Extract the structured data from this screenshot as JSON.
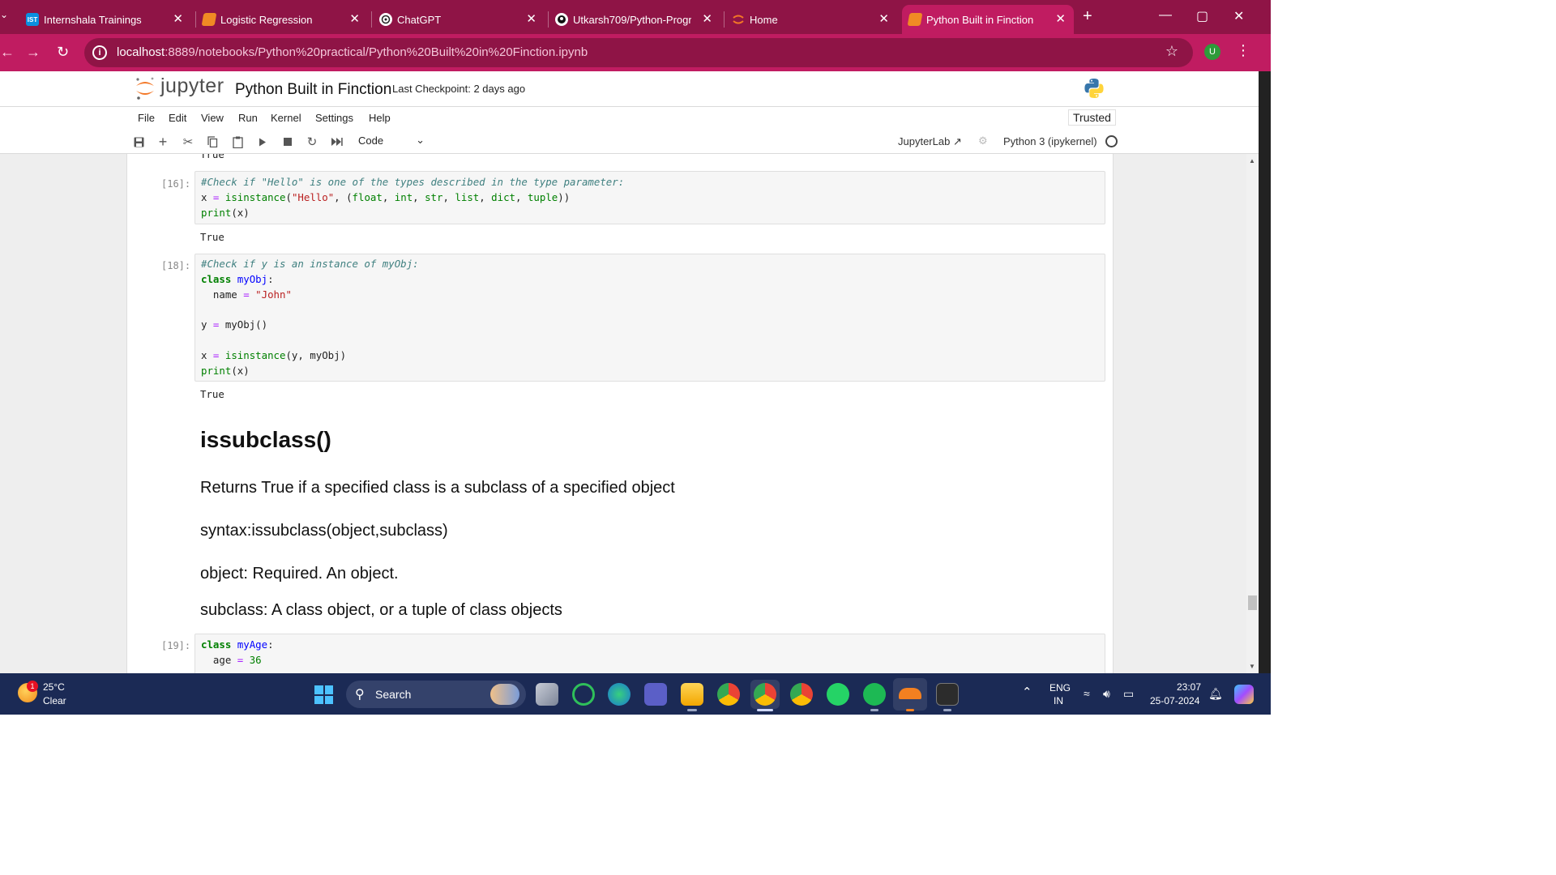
{
  "browser": {
    "tabs": [
      {
        "label": "Internshala Trainings",
        "icon": "internshala-icon",
        "icon_text": "IST",
        "active": false
      },
      {
        "label": "Logistic Regression",
        "icon": "jupyter-notebook-icon",
        "active": false
      },
      {
        "label": "ChatGPT",
        "icon": "chatgpt-icon",
        "active": false
      },
      {
        "label": "Utkarsh709/Python-Progra",
        "icon": "github-icon",
        "active": false
      },
      {
        "label": "Home",
        "icon": "jupyter-icon",
        "active": false
      },
      {
        "label": "Python Built in Finction",
        "icon": "jupyter-notebook-icon",
        "active": true
      }
    ],
    "url_host": "localhost",
    "url_rest": ":8889/notebooks/Python%20practical/Python%20Built%20in%20Finction.ipynb",
    "profile_initial": "U"
  },
  "jupyter": {
    "logo_text": "jupyter",
    "notebook_title": "Python Built in Finction",
    "checkpoint": "Last Checkpoint: 2 days ago",
    "menu": [
      "File",
      "Edit",
      "View",
      "Run",
      "Kernel",
      "Settings",
      "Help"
    ],
    "trusted": "Trusted",
    "cell_type": "Code",
    "jupyterlab_link": "JupyterLab",
    "kernel": "Python 3 (ipykernel)"
  },
  "notebook": {
    "prev_output": "True",
    "cell16": {
      "prompt": "[16]:",
      "comment": "#Check if \"Hello\" is one of the types described in the type parameter:",
      "output": "True"
    },
    "cell18": {
      "prompt": "[18]:",
      "comment": "#Check if y is an instance of myObj:",
      "output": "True"
    },
    "markdown": {
      "heading": "issubclass()",
      "p1": "Returns True if a specified class is a subclass of a specified object",
      "p2": "syntax:issubclass(object,subclass)",
      "p3": "object: Required. An object.",
      "p4": "subclass: A class object, or a tuple of class objects"
    },
    "cell19": {
      "prompt": "[19]:"
    }
  },
  "taskbar": {
    "weather_temp": "25°C",
    "weather_cond": "Clear",
    "weather_badge": "1",
    "search": "Search",
    "lang_top": "ENG",
    "lang_bottom": "IN",
    "time": "23:07",
    "date": "25-07-2024"
  },
  "colors": {
    "chrome_dark": "#8f1446",
    "chrome_active": "#c01c61",
    "taskbar": "#1b2a55",
    "accent_blue": "#4cc2ff"
  }
}
